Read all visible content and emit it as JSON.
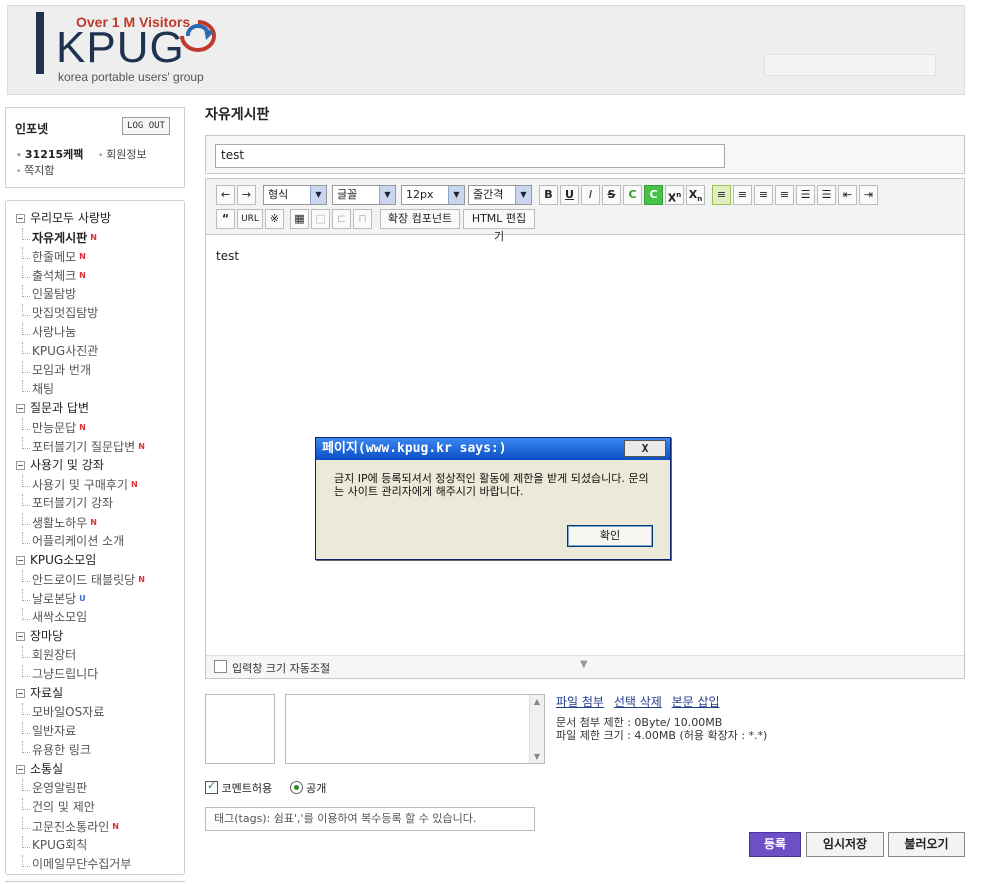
{
  "header": {
    "logo_text": "KPUG",
    "logo_visitors": "Over 1 M Visitors",
    "logo_sub": "korea portable users' group"
  },
  "user": {
    "name": "인포넷",
    "logout_label": "LOG OUT",
    "points": "31215케팩",
    "member_info": "회원정보",
    "memo": "쪽지함"
  },
  "menu": [
    {
      "type": "group",
      "label": "우리모두 사랑방"
    },
    {
      "type": "item",
      "label": "자유게시판",
      "new": true,
      "active": true
    },
    {
      "type": "item",
      "label": "한줄메모",
      "new": true
    },
    {
      "type": "item",
      "label": "출석체크",
      "new": true
    },
    {
      "type": "item",
      "label": "인물탐방"
    },
    {
      "type": "item",
      "label": "맛집멋집탐방"
    },
    {
      "type": "item",
      "label": "사랑나눔"
    },
    {
      "type": "item",
      "label": "KPUG사진관"
    },
    {
      "type": "item",
      "label": "모임과 번개"
    },
    {
      "type": "item",
      "label": "채팅"
    },
    {
      "type": "group",
      "label": "질문과 답변"
    },
    {
      "type": "item",
      "label": "만능문답",
      "new": true
    },
    {
      "type": "item",
      "label": "포터블기기 질문답변",
      "new": true
    },
    {
      "type": "group",
      "label": "사용기 및 강좌"
    },
    {
      "type": "item",
      "label": "사용기 및 구매후기",
      "new": true
    },
    {
      "type": "item",
      "label": "포터블기기 강좌"
    },
    {
      "type": "item",
      "label": "생활노하우",
      "new": true
    },
    {
      "type": "item",
      "label": "어플리케이션 소개"
    },
    {
      "type": "group",
      "label": "KPUG소모임"
    },
    {
      "type": "item",
      "label": "안드로이드 태블릿당",
      "new": true
    },
    {
      "type": "item",
      "label": "날로본당",
      "mark": "U"
    },
    {
      "type": "item",
      "label": "새싹소모임"
    },
    {
      "type": "group",
      "label": "장마당"
    },
    {
      "type": "item",
      "label": "회원장터"
    },
    {
      "type": "item",
      "label": "그냥드립니다"
    },
    {
      "type": "group",
      "label": "자료실"
    },
    {
      "type": "item",
      "label": "모바일OS자료"
    },
    {
      "type": "item",
      "label": "일반자료"
    },
    {
      "type": "item",
      "label": "유용한 링크"
    },
    {
      "type": "group",
      "label": "소통실"
    },
    {
      "type": "item",
      "label": "운영알림판"
    },
    {
      "type": "item",
      "label": "건의 및 제안"
    },
    {
      "type": "item",
      "label": "고문진소통라인",
      "new": true
    },
    {
      "type": "item",
      "label": "KPUG회칙"
    },
    {
      "type": "item",
      "label": "이메일무단수집거부"
    }
  ],
  "board": {
    "title": "자유게시판",
    "post_title_value": "test",
    "content_text": "test"
  },
  "toolbar": {
    "format_select": "형식",
    "font_select": "글꼴",
    "size_select": "12px",
    "lineheight_select": "줄간격",
    "extend_component": "확장 컴포넌트",
    "html_edit": "HTML 편집기",
    "url_label": "URL",
    "quote_label": "“",
    "special_char": "※",
    "bold": "B",
    "underline": "U",
    "italic": "I",
    "strike": "S",
    "color_font": "C",
    "color_bg": "C",
    "superscript": "X",
    "subscript": "X"
  },
  "editor_footer": {
    "autosize_label": "입력창 크기 자동조절"
  },
  "attach": {
    "link_file": "파일 첨부",
    "link_delete": "선택 삭제",
    "link_insert": "본문 삽입",
    "limit_doc": "문서 첨부 제한 : 0Byte/ 10.00MB",
    "limit_file": "파일 제한 크기 : 4.00MB (허용 확장자 : *.*)"
  },
  "options": {
    "allow_comment": "코멘트허용",
    "public": "공개",
    "tags_placeholder": "태그(tags): 쉼표','를 이용하여 복수등록 할 수 있습니다."
  },
  "buttons": {
    "submit": "등록",
    "temp_save": "임시저장",
    "load": "불러오기"
  },
  "dialog": {
    "title": "페이지(www.kpug.kr says:)",
    "close": "X",
    "message": "금지 IP에 등록되셔서 정상적인 활동에 제한을 받게 되셨습니다. 문의는 사이트 관리자에게 해주시기 바랍니다.",
    "ok": "확인"
  }
}
